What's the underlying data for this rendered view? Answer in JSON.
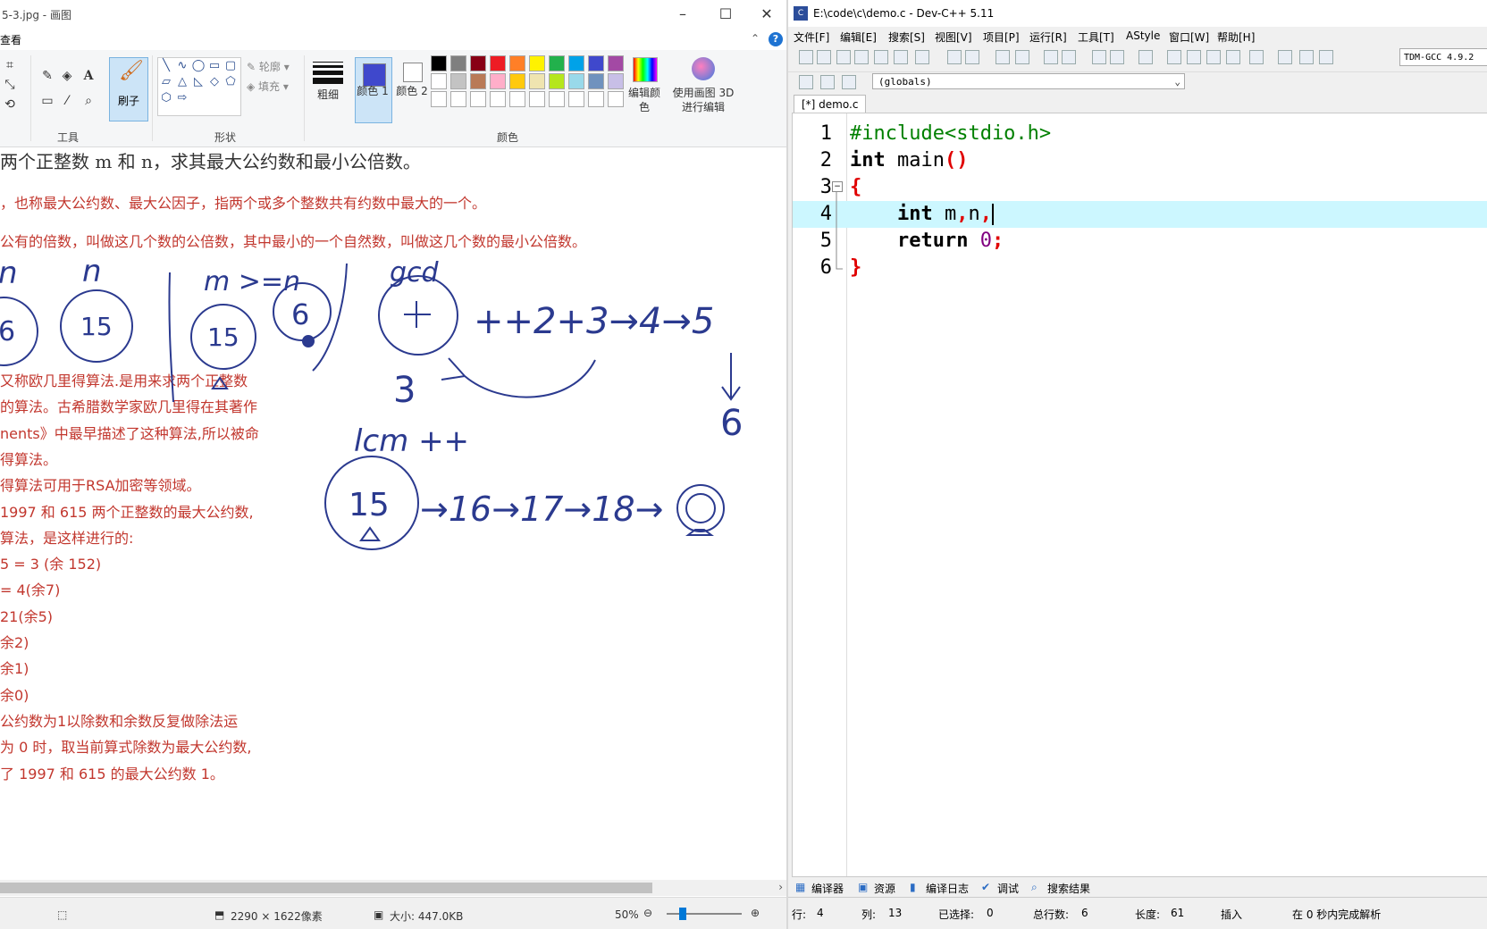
{
  "paint": {
    "title": "5-3.jpg - 画图",
    "view_tab": "查看",
    "groups": {
      "tools": "工具",
      "shapes": "形状",
      "colors": "颜色"
    },
    "brush_label": "刷子",
    "outline_label": "轮廓",
    "fill_label": "填充",
    "thickness_label": "粗细",
    "color1_label": "颜色 1",
    "color2_label": "颜色 2",
    "edit_colors_label": "编辑颜色",
    "paint3d_label": "使用画图 3D 进行编辑",
    "palette": [
      "#000000",
      "#7f7f7f",
      "#880015",
      "#ed1c24",
      "#ff7f27",
      "#fff200",
      "#22b14c",
      "#00a2e8",
      "#3f48cc",
      "#a349a4",
      "#ffffff",
      "#c3c3c3",
      "#b97a57",
      "#ffaec9",
      "#ffc90e",
      "#efe4b0",
      "#b5e61d",
      "#99d9ea",
      "#7092be",
      "#c8bfe7",
      "#ffffff",
      "#ffffff",
      "#ffffff",
      "#ffffff",
      "#ffffff",
      "#ffffff",
      "#ffffff",
      "#ffffff",
      "#ffffff",
      "#ffffff"
    ],
    "image": {
      "line1": "两个正整数 m 和 n，求其最大公约数和最小公倍数。",
      "line2": "，也称最大公约数、最大公因子，指两个或多个整数共有约数中最大的一个。",
      "line3": "公有的倍数，叫做这几个数的公倍数，其中最小的一个自然数，叫做这几个数的最小公倍数。",
      "paragraph": [
        "又称欧几里得算法.是用来求两个正整数",
        "的算法。古希腊数学家欧几里得在其著作",
        "nents》中最早描述了这种算法,所以被命",
        "得算法。",
        "得算法可用于RSA加密等领域。",
        "1997 和 615 两个正整数的最大公约数,",
        "算法，是这样进行的:",
        "5 = 3 (余 152)",
        "= 4(余7)",
        "21(余5)",
        "余2)",
        "余1)",
        "余0)",
        "公约数为1以除数和余数反复做除法运",
        "为 0 时，取当前算式除数为最大公约数,",
        "了 1997 和 615 的最大公约数 1。"
      ],
      "hand": {
        "top_n_left": "n",
        "top_n": "n",
        "circle_left": "6",
        "circle_15a": "15",
        "label_m_ge_n": "m >=n",
        "circle_15b": "15",
        "circle_6b": "6",
        "gcd": "gcd",
        "gcd_seq": "++2+3→4→5",
        "three": "3",
        "six": "6",
        "lcm": "lcm ++",
        "circle_15c": "15",
        "lcm_seq": "→16→17→18→"
      }
    },
    "status": {
      "dimensions": "2290 × 1622像素",
      "size": "大小: 447.0KB",
      "zoom": "50%"
    }
  },
  "devcpp": {
    "title": "E:\\code\\c\\demo.c - Dev-C++ 5.11",
    "menu": [
      "文件[F]",
      "编辑[E]",
      "搜索[S]",
      "视图[V]",
      "项目[P]",
      "运行[R]",
      "工具[T]",
      "AStyle",
      "窗口[W]",
      "帮助[H]"
    ],
    "compiler": "TDM-GCC 4.9.2",
    "scope": "(globals)",
    "tab": "[*] demo.c",
    "lines": [
      "1",
      "2",
      "3",
      "4",
      "5",
      "6"
    ],
    "code": {
      "l1": "#include<stdio.h>",
      "l2_kw": "int",
      "l2_rest": " main",
      "l2_paren": "()",
      "l3": "{",
      "l4_kw": "int",
      "l4_a": " m",
      "l4_c1": ",",
      "l4_b": "n",
      "l4_c2": ",",
      "l5_kw": "return",
      "l5_num": "0",
      "l5_semi": ";",
      "l6": "}"
    },
    "bottom_tabs": [
      "编译器",
      "资源",
      "编译日志",
      "调试",
      "搜索结果"
    ],
    "status": {
      "row_label": "行:",
      "row": "4",
      "col_label": "列:",
      "col": "13",
      "sel_label": "已选择:",
      "sel": "0",
      "total_label": "总行数:",
      "total": "6",
      "len_label": "长度:",
      "len": "61",
      "mode": "插入",
      "parse": "在 0 秒内完成解析"
    }
  }
}
